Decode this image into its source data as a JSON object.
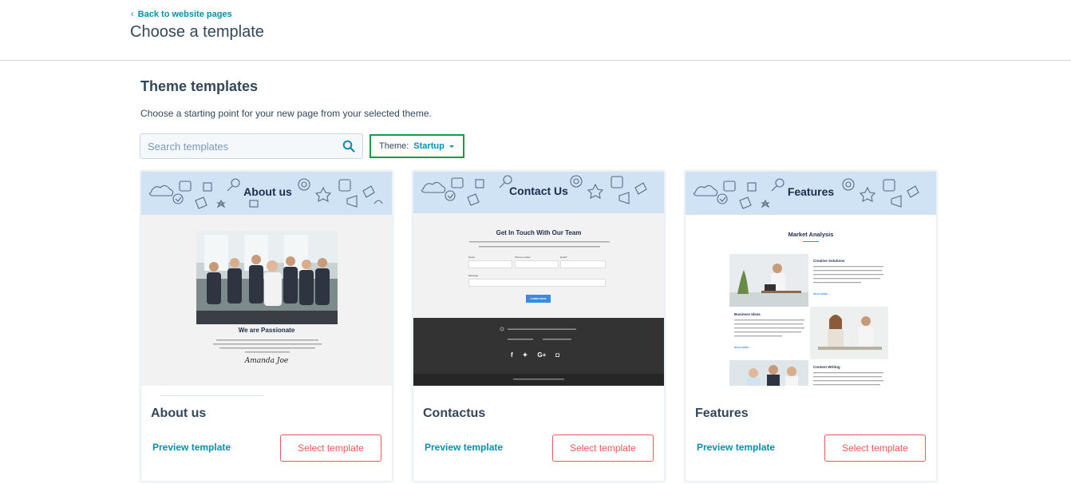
{
  "header": {
    "back_label": "Back to website pages",
    "title": "Choose a template"
  },
  "section": {
    "title": "Theme templates",
    "description": "Choose a starting point for your new page from your selected theme."
  },
  "search": {
    "placeholder": "Search templates",
    "value": ""
  },
  "theme_filter": {
    "label": "Theme:",
    "value": "Startup"
  },
  "colors": {
    "accent": "#0091ae",
    "select_button": "#f2545b",
    "highlight_border": "#1a9c3e",
    "banner": "#cfe3f5"
  },
  "cards": [
    {
      "name": "About us",
      "preview_label": "Preview template",
      "select_label": "Select template",
      "thumb": {
        "banner_title": "About us",
        "heading": "We are Passionate",
        "signature": "Amanda Joe"
      }
    },
    {
      "name": "Contactus",
      "preview_label": "Preview template",
      "select_label": "Select template",
      "thumb": {
        "banner_title": "Contact Us",
        "heading": "Get In Touch With Our Team",
        "field_name": "Name",
        "field_phone": "Phone number",
        "field_email": "Email*",
        "field_message": "Message",
        "submit": "SUBMIT NOW"
      }
    },
    {
      "name": "Features",
      "preview_label": "Preview template",
      "select_label": "Select template",
      "thumb": {
        "banner_title": "Features",
        "heading": "Market Analysis",
        "item1": "Creative Solutions",
        "item2": "Business Ideas",
        "item3": "Content Writing",
        "read_more": "READ MORE"
      }
    }
  ]
}
